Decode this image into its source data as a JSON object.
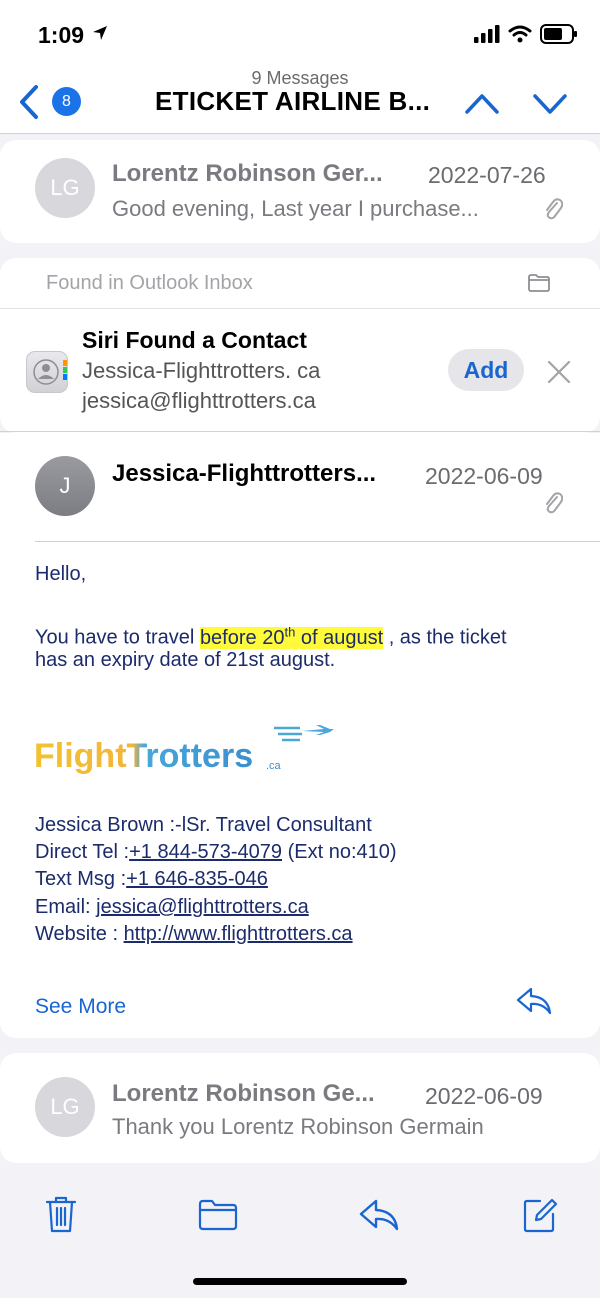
{
  "status_bar": {
    "time": "1:09"
  },
  "nav": {
    "badge": "8",
    "subtitle": "9 Messages",
    "title": "ETICKET AIRLINE B..."
  },
  "messages": [
    {
      "initials": "LG",
      "sender": "Lorentz Robinson Ger...",
      "date": "2022-07-26",
      "preview": "Good evening, Last year I purchase..."
    }
  ],
  "siri": {
    "found_in": "Found in Outlook Inbox",
    "title": "Siri Found a Contact",
    "name": "Jessica-Flighttrotters. ca",
    "email": "jessica@flighttrotters.ca",
    "add_label": "Add"
  },
  "expanded": {
    "initials": "J",
    "sender": "Jessica-Flighttrotters...",
    "date": "2022-06-09",
    "greeting": "Hello,",
    "line1_pre": "You have to travel ",
    "line1_hl_a": "before 20",
    "line1_sup": "th",
    "line1_hl_b": "  of  august",
    "line1_post": " , as the ticket",
    "line2": "has an expiry date of 21st  august.",
    "logo_text": "FlightTrotters",
    "logo_suffix": ".ca",
    "sig_name": "Jessica Brown :-lSr. Travel Consultant",
    "direct_label": "Direct Tel :",
    "direct_tel": "+1 844-573-4079",
    "direct_ext": " (Ext no:410)",
    "text_label": "Text Msg :",
    "text_tel": "+1 646-835-046",
    "email_label": "Email: ",
    "email_val": " jessica@flighttrotters.ca",
    "web_label": "Website : ",
    "web_val": "http://www.flighttrotters.ca",
    "see_more": "See More"
  },
  "last": {
    "initials": "LG",
    "sender": "Lorentz Robinson Ge...",
    "date": "2022-06-09",
    "preview": "Thank you Lorentz Robinson Germain"
  },
  "colors": {
    "accent": "#1a66d0",
    "highlight": "#fffb3a",
    "body_text": "#1c2b6b"
  }
}
